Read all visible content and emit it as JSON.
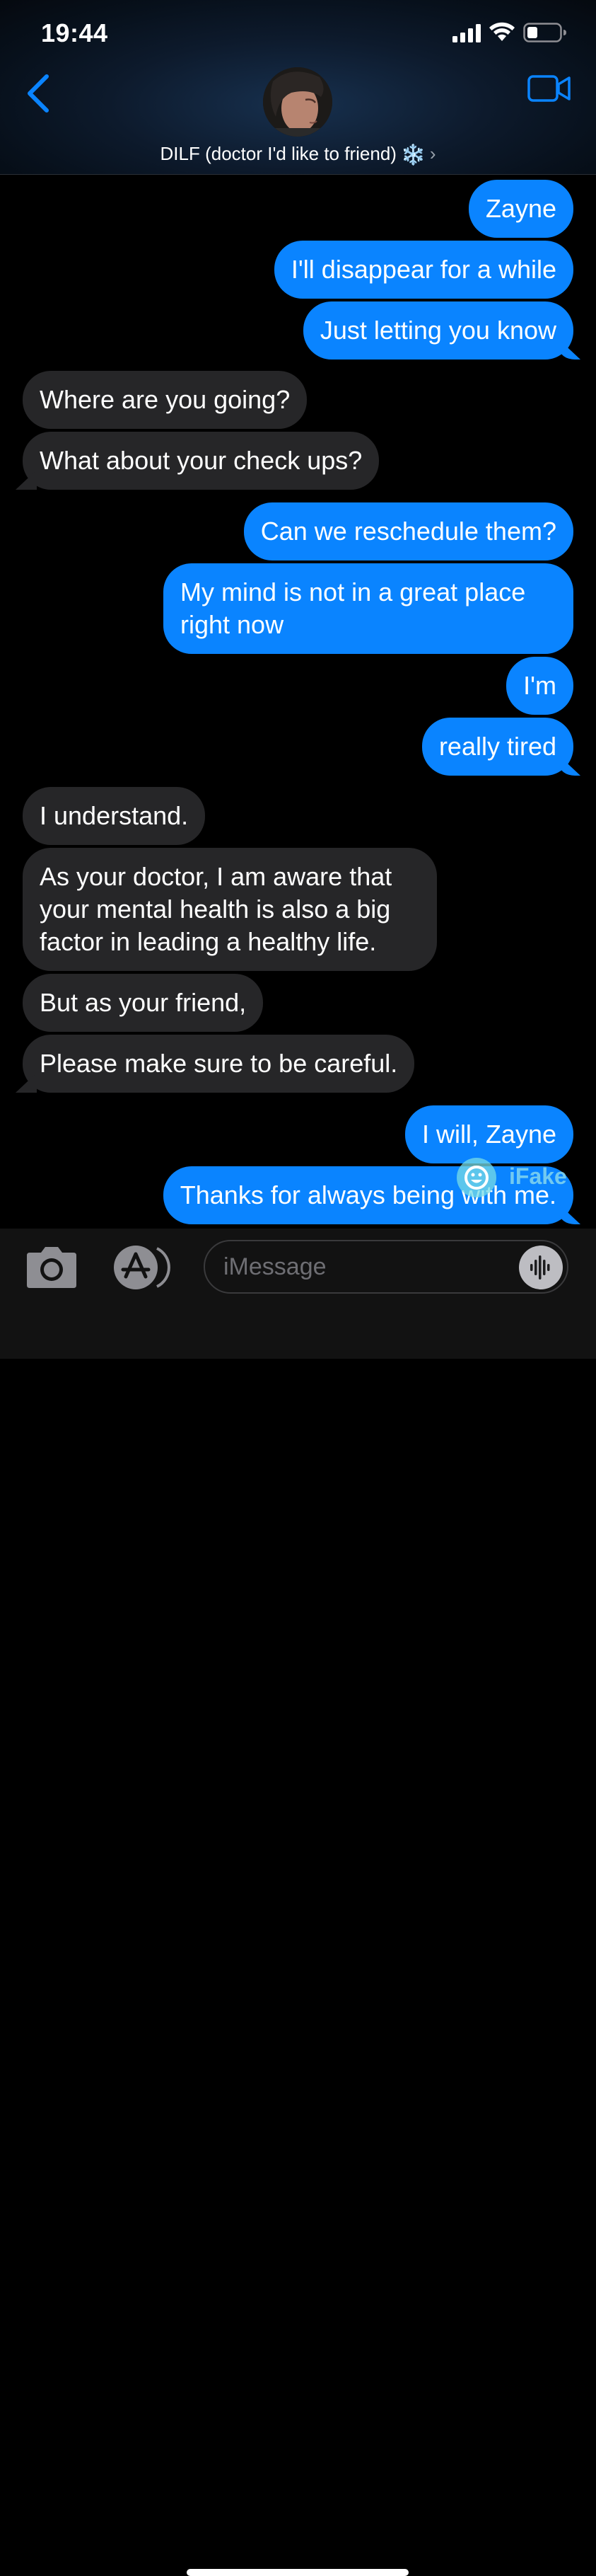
{
  "status_bar": {
    "time": "19:44"
  },
  "header": {
    "contact_name": "DILF (doctor I'd like to friend)",
    "contact_emoji": "❄️",
    "chevron": "›",
    "icons": {
      "back": "chevron-left-icon",
      "video": "video-camera-icon"
    },
    "accent_color": "#0a84ff"
  },
  "messages": [
    {
      "from": "me",
      "text": "Zayne"
    },
    {
      "from": "me",
      "text": "I'll disappear for a while"
    },
    {
      "from": "me",
      "text": "Just letting you know"
    },
    {
      "from": "them",
      "text": "Where are you going?"
    },
    {
      "from": "them",
      "text": "What about your check ups?"
    },
    {
      "from": "me",
      "text": "Can we reschedule them?"
    },
    {
      "from": "me",
      "text": "My mind is not in a great place right now"
    },
    {
      "from": "me",
      "text": "I'm"
    },
    {
      "from": "me",
      "text": "really tired"
    },
    {
      "from": "them",
      "text": "I understand."
    },
    {
      "from": "them",
      "text": "As your doctor, I am aware that your mental health is also a big factor in leading a healthy life."
    },
    {
      "from": "them",
      "text": "But as your friend,"
    },
    {
      "from": "them",
      "text": "Please make sure to be careful."
    },
    {
      "from": "me",
      "text": "I will, Zayne"
    },
    {
      "from": "me",
      "text": "Thanks for always being with me."
    }
  ],
  "watermark": {
    "text": "iFake"
  },
  "composer": {
    "placeholder": "iMessage",
    "value": "",
    "icons": {
      "camera": "camera-icon",
      "apps": "app-store-icon",
      "audio": "audio-waveform-icon"
    }
  },
  "colors": {
    "outgoing_bubble": "#0a84ff",
    "incoming_bubble": "#262628",
    "background": "#000000"
  }
}
